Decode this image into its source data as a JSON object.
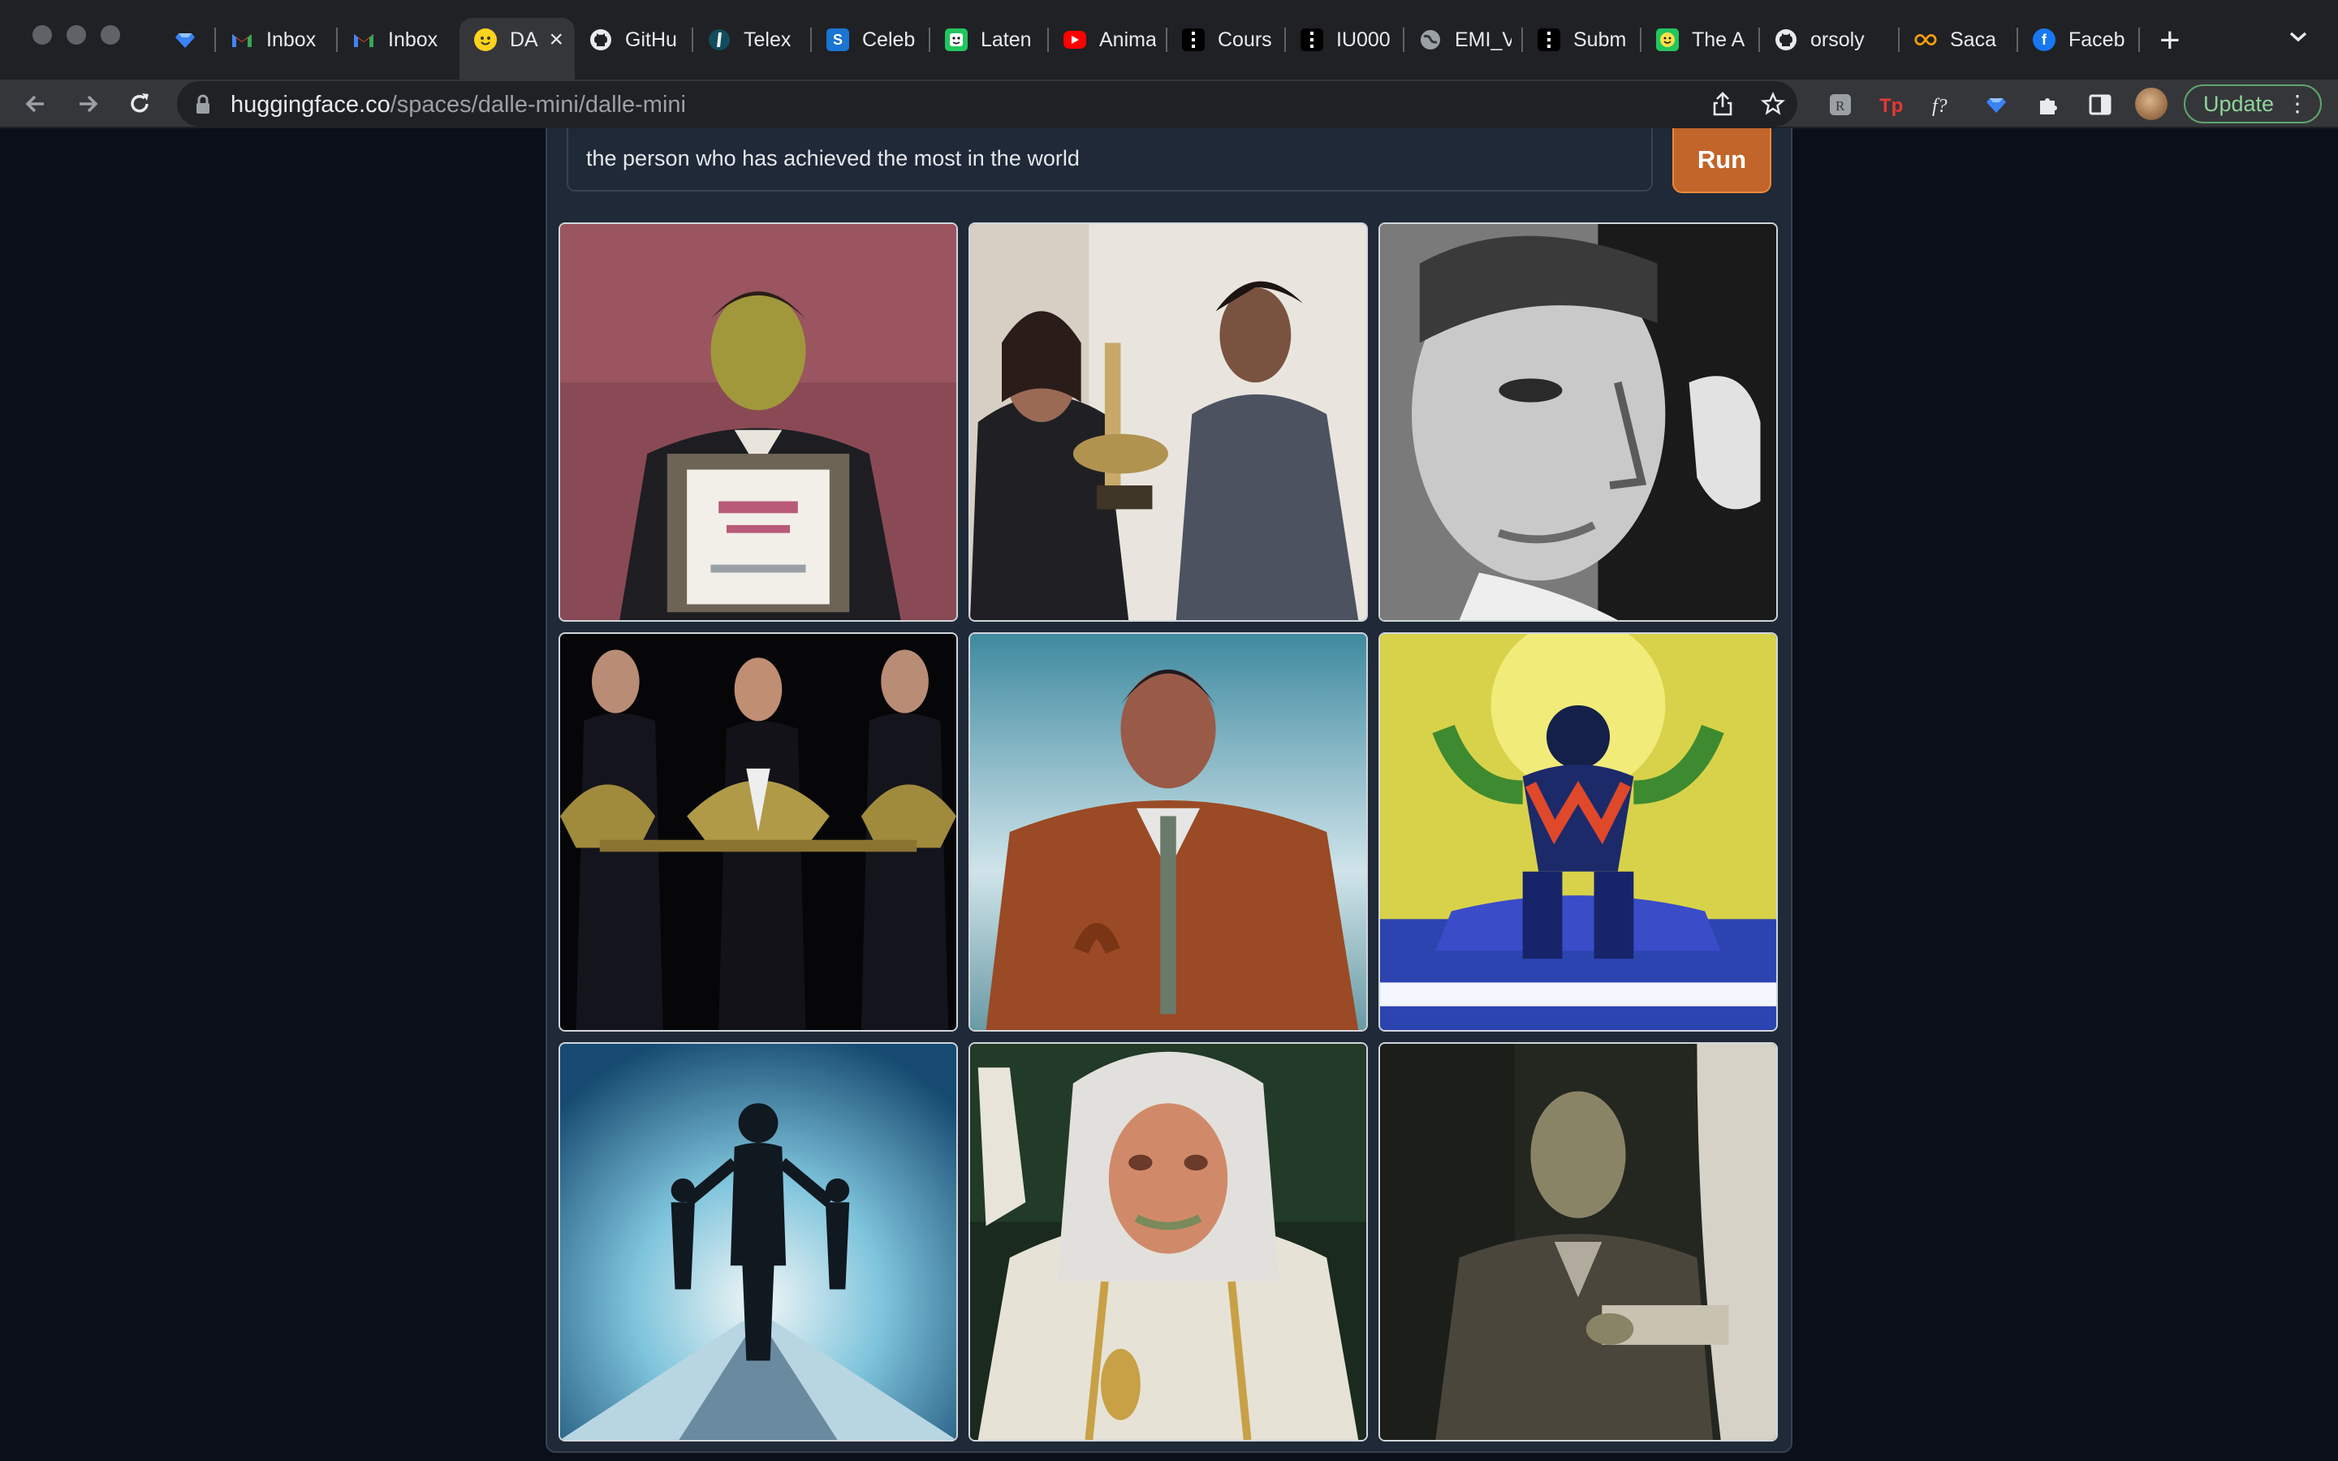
{
  "browser": {
    "tabs": [
      {
        "label": "",
        "icon": "sapphire-favicon",
        "active": false
      },
      {
        "label": "Inbox",
        "icon": "gmail-favicon",
        "active": false
      },
      {
        "label": "Inbox",
        "icon": "gmail-favicon",
        "active": false
      },
      {
        "label": "DA",
        "icon": "huggingface-favicon",
        "active": true
      },
      {
        "label": "GitHu",
        "icon": "github-favicon",
        "active": false
      },
      {
        "label": "Telex",
        "icon": "telex-favicon",
        "active": false
      },
      {
        "label": "Celeb",
        "icon": "celeb-favicon",
        "active": false
      },
      {
        "label": "Laten",
        "icon": "latent-favicon",
        "active": false
      },
      {
        "label": "Anima",
        "icon": "youtube-favicon",
        "active": false
      },
      {
        "label": "Cours",
        "icon": "course-favicon",
        "active": false
      },
      {
        "label": "IU000",
        "icon": "course-favicon",
        "active": false
      },
      {
        "label": "EMI_V",
        "icon": "globe-favicon",
        "active": false
      },
      {
        "label": "Subm",
        "icon": "course-favicon",
        "active": false
      },
      {
        "label": "The A",
        "icon": "smiley-favicon",
        "active": false
      },
      {
        "label": "orsoly",
        "icon": "github-favicon",
        "active": false
      },
      {
        "label": "Saca",
        "icon": "infinity-favicon",
        "active": false
      },
      {
        "label": "Faceb",
        "icon": "facebook-favicon",
        "active": false
      }
    ],
    "new_tab_symbol": "+",
    "close_symbol": "×",
    "url_domain": "huggingface.co",
    "url_path": "/spaces/dalle-mini/dalle-mini",
    "update_label": "Update",
    "kebab": "⋮"
  },
  "app": {
    "prompt_value": "the person who has achieved the most in the world",
    "run_label": "Run",
    "images": [
      {
        "name": "generated-image-1",
        "subject": "man in suit holding framed certificate"
      },
      {
        "name": "generated-image-2",
        "subject": "two people with trophy"
      },
      {
        "name": "generated-image-3",
        "subject": "black and white portrait of man"
      },
      {
        "name": "generated-image-4",
        "subject": "three figures with golden objects"
      },
      {
        "name": "generated-image-5",
        "subject": "man in brown jacket against sky"
      },
      {
        "name": "generated-image-6",
        "subject": "abstract figure with raised arms under sun"
      },
      {
        "name": "generated-image-7",
        "subject": "silhouette of adult holding two children"
      },
      {
        "name": "generated-image-8",
        "subject": "elderly figure in white robe"
      },
      {
        "name": "generated-image-9",
        "subject": "man in tweed jacket holding paper"
      }
    ]
  },
  "colors": {
    "page_bg": "#0b0f19",
    "panel_bg": "#1f2937",
    "run_button": "#c2652a",
    "update_border": "#5fa56a"
  }
}
